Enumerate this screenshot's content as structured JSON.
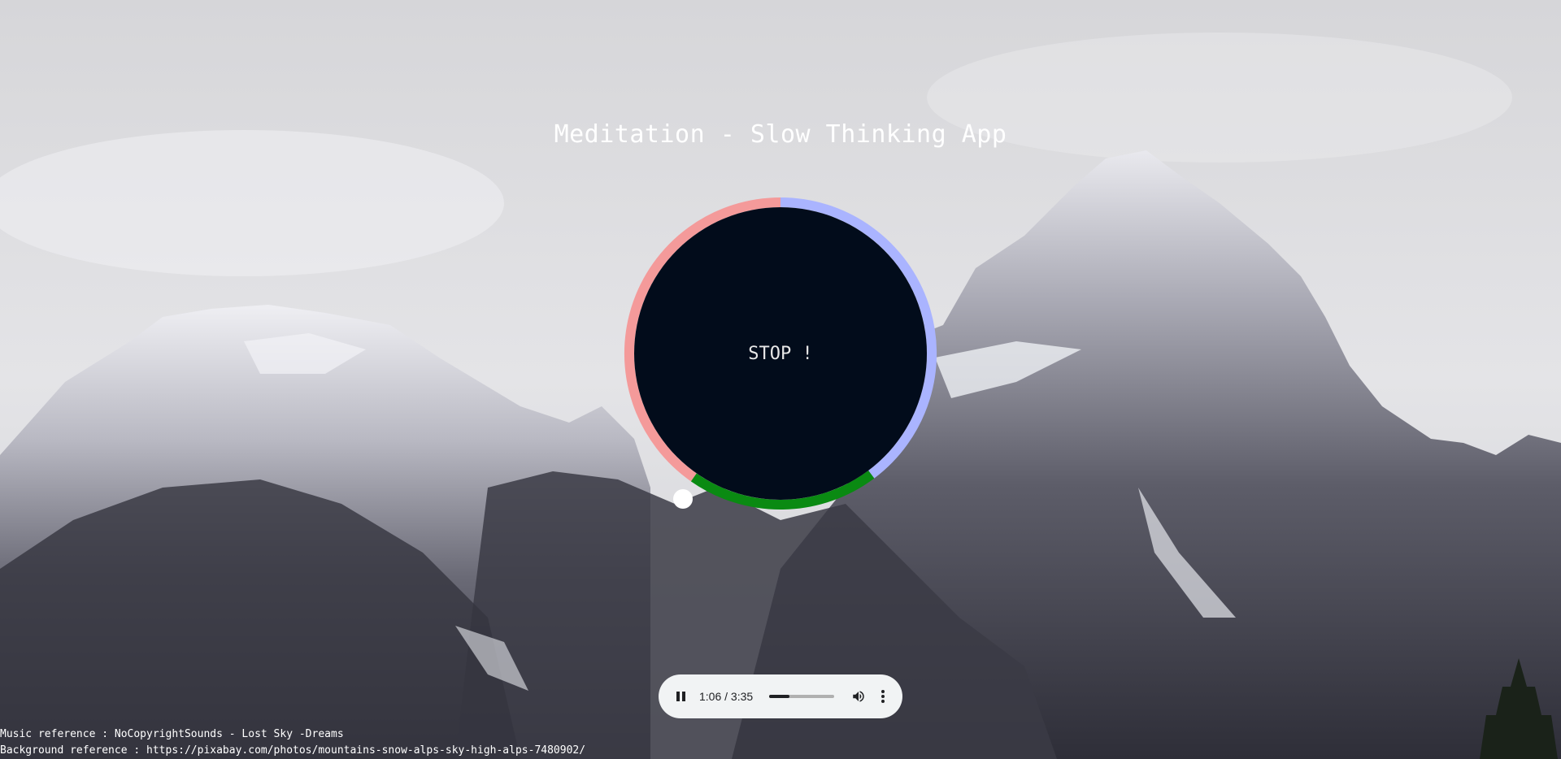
{
  "app": {
    "title": "Meditation - Slow Thinking App"
  },
  "timer": {
    "button_label": "STOP !",
    "face_color": "#020c1b",
    "ring_colors": {
      "inhale": "#f08b8b",
      "hold": "#aab4ff",
      "exhale": "#0a8a12"
    },
    "indicator_color": "#ffffff"
  },
  "audio_player": {
    "time_text": "1:06 / 3:35",
    "progress": 0.307,
    "play_state_icon": "pause-icon",
    "volume_icon": "volume-icon",
    "menu_icon": "more-vert-icon"
  },
  "references": {
    "music": "Music reference : NoCopyrightSounds - Lost Sky -Dreams",
    "background": "Background reference : https://pixabay.com/photos/mountains-snow-alps-sky-high-alps-7480902/"
  }
}
